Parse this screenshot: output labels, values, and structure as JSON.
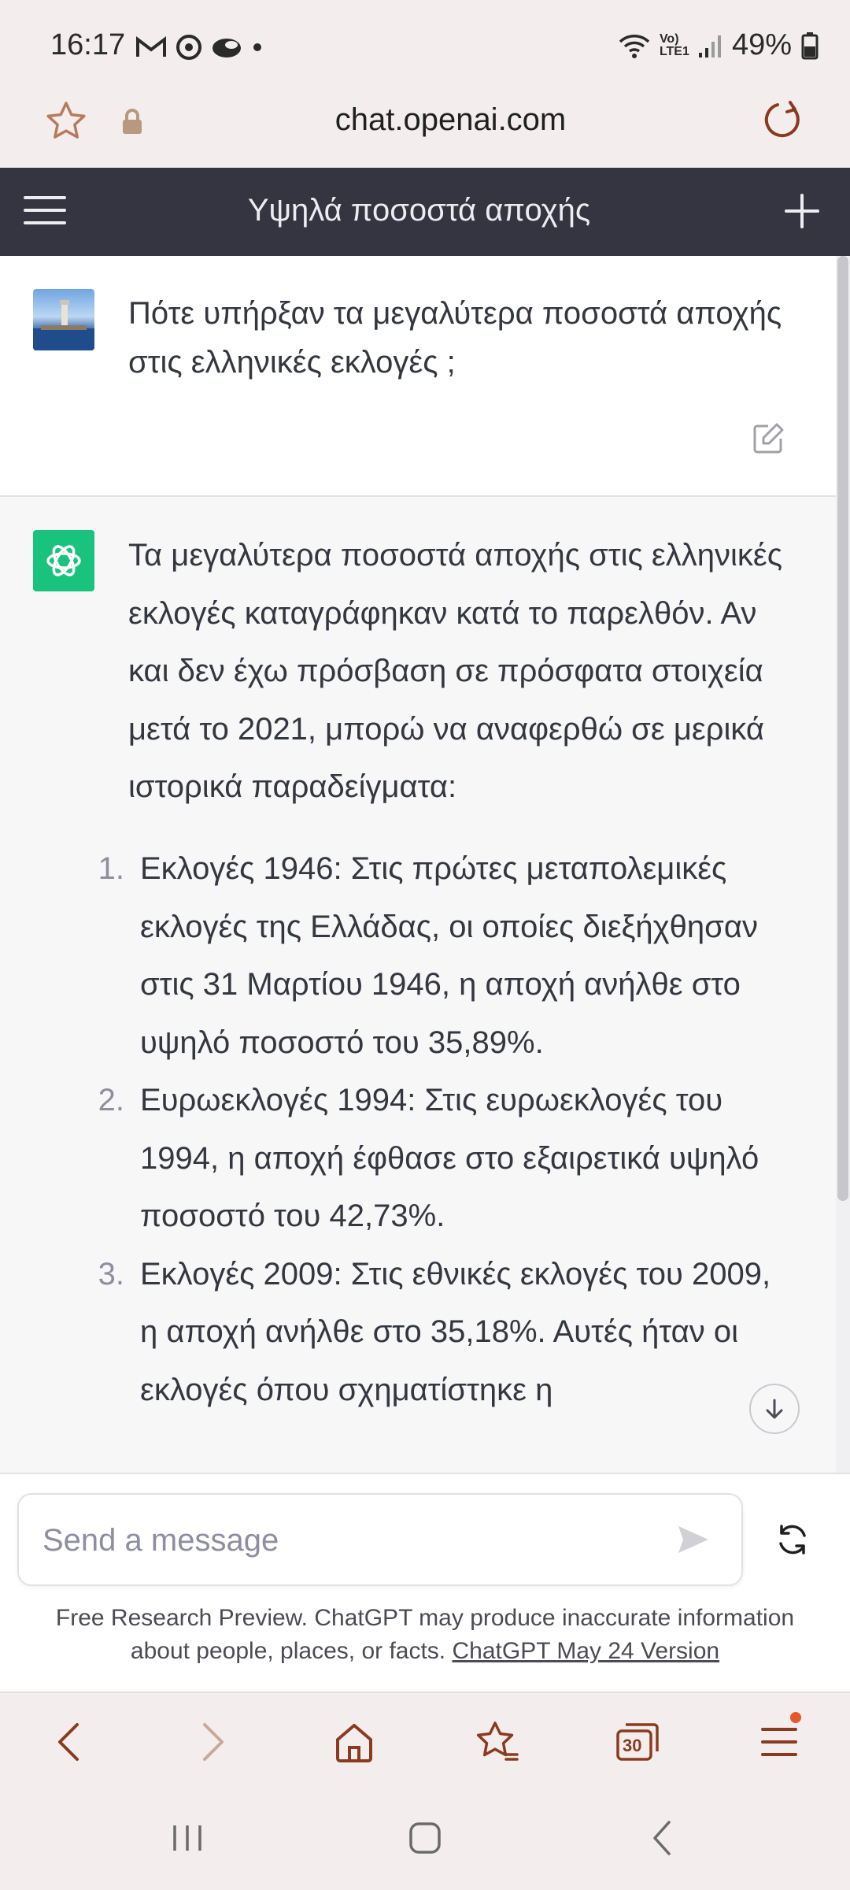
{
  "status_bar": {
    "time": "16:17",
    "battery": "49%",
    "network_label": "Vo) LTE1"
  },
  "browser": {
    "url": "chat.openai.com"
  },
  "chat": {
    "title": "Υψηλά ποσοστά αποχής",
    "user_message": "Πότε υπήρξαν τα μεγαλύτερα ποσοστά αποχής στις ελληνικές εκλογές ;",
    "assistant_intro": "Τα μεγαλύτερα ποσοστά αποχής στις ελληνικές εκλογές καταγράφηκαν κατά το παρελθόν. Αν και δεν έχω πρόσβαση σε πρόσφατα στοιχεία μετά το 2021, μπορώ να αναφερθώ σε μερικά ιστορικά παραδείγματα:",
    "list": [
      {
        "num": "1.",
        "text": "Εκλογές 1946: Στις πρώτες μεταπολεμικές εκλογές της Ελλάδας, οι οποίες διεξήχθησαν στις 31 Μαρτίου 1946, η αποχή ανήλθε στο υψηλό ποσοστό του 35,89%."
      },
      {
        "num": "2.",
        "text": "Ευρωεκλογές 1994: Στις ευρωεκλογές του 1994, η αποχή έφθασε στο εξαιρετικά υψηλό ποσοστό του 42,73%."
      },
      {
        "num": "3.",
        "text": "Εκλογές 2009: Στις εθνικές εκλογές του 2009, η αποχή ανήλθε στο 35,18%. Αυτές ήταν οι εκλογές όπου σχηματίστηκε η"
      }
    ]
  },
  "composer": {
    "placeholder": "Send a message",
    "disclaimer_text": "Free Research Preview. ChatGPT may produce inaccurate information about people, places, or facts. ",
    "disclaimer_link": "ChatGPT May 24 Version"
  },
  "browser_nav": {
    "tabs_count": "30",
    "accent_color": "#8a3b1f"
  },
  "colors": {
    "header_bg": "#343541",
    "gpt_green": "#19c37d",
    "notification": "#e8562b"
  }
}
